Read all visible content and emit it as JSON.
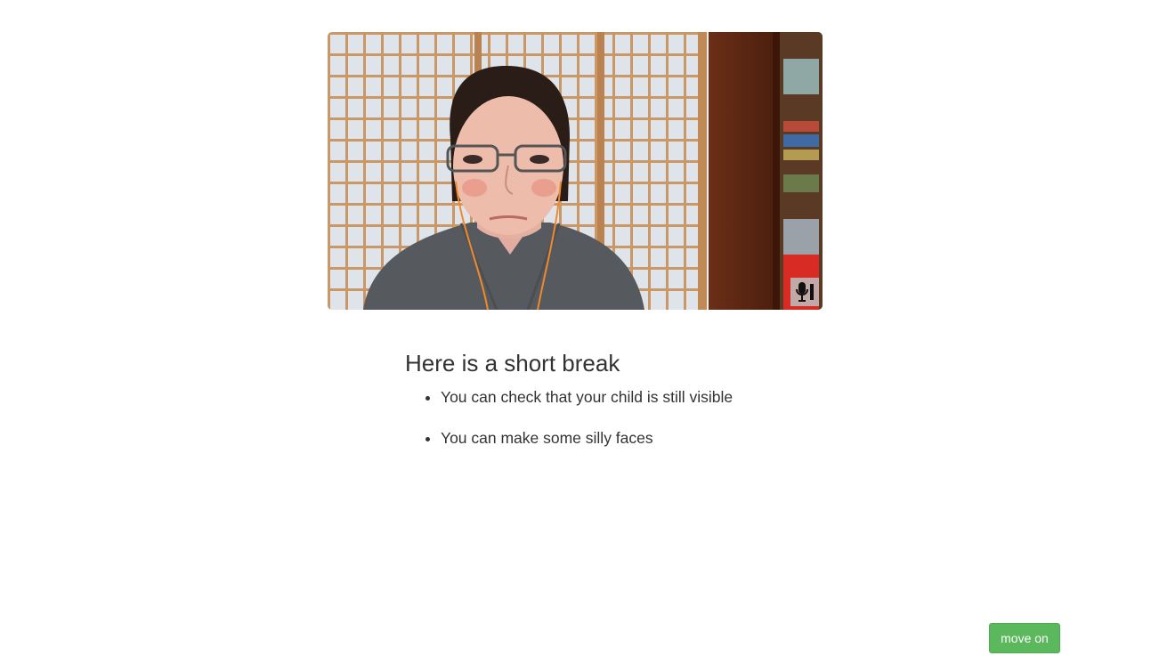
{
  "webcam": {
    "mic_icon": "microphone-icon"
  },
  "break": {
    "title": "Here is a short break",
    "items": [
      "You can check that your child is still visible",
      "You can make some silly faces"
    ]
  },
  "controls": {
    "next_label": "move on"
  },
  "colors": {
    "next_button": "#5cb85c",
    "next_button_border": "#4cae4c",
    "text": "#333333"
  }
}
